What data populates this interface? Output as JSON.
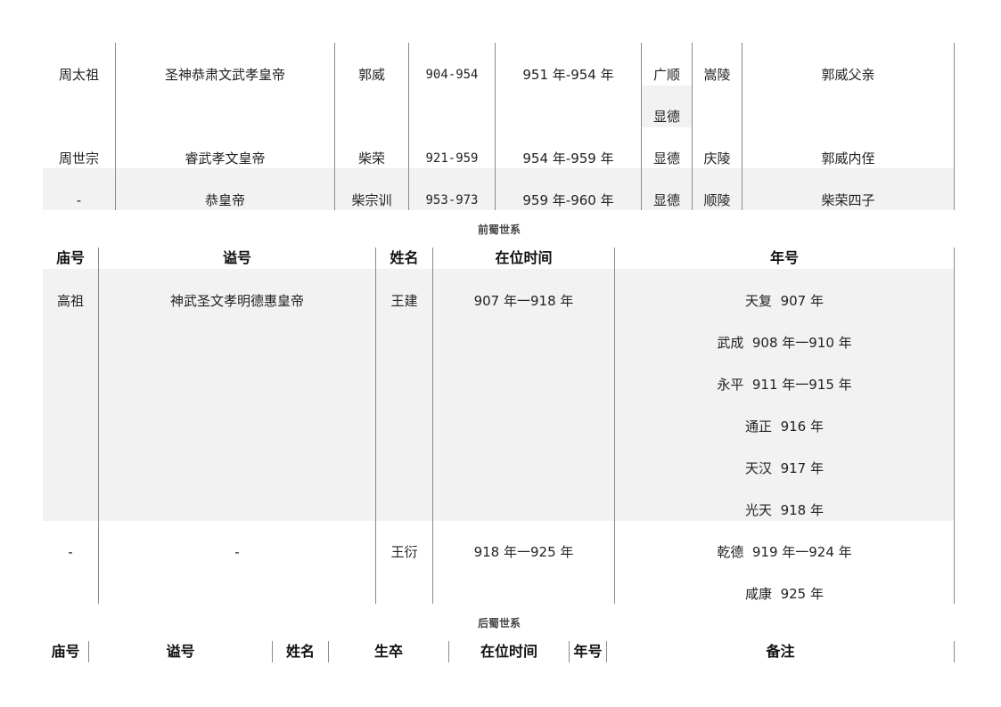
{
  "zhou_table": {
    "rows": [
      {
        "temple": "周太祖",
        "posthumous": "圣神恭肃文武孝皇帝",
        "name": "郭威",
        "life": "904-954",
        "reign": "951 年-954 年",
        "era": [
          "广顺",
          "显德"
        ],
        "tomb": "嵩陵",
        "note": "郭威父亲"
      },
      {
        "temple": "周世宗",
        "posthumous": "睿武孝文皇帝",
        "name": "柴荣",
        "life": "921-959",
        "reign": "954 年-959 年",
        "era": [
          "显德"
        ],
        "tomb": "庆陵",
        "note": "郭威内侄"
      },
      {
        "temple": "-",
        "posthumous": "恭皇帝",
        "name": "柴宗训",
        "life": "953-973",
        "reign": "959 年-960 年",
        "era": [
          "显德"
        ],
        "tomb": "顺陵",
        "note": "柴荣四子"
      }
    ]
  },
  "qianshu": {
    "caption": "前蜀世系",
    "headers": [
      "庙号",
      "谥号",
      "姓名",
      "在位时间",
      "年号"
    ],
    "rows": [
      {
        "temple": "高祖",
        "posthumous": "神武圣文孝明德惠皇帝",
        "name": "王建",
        "reign": "907 年一918 年",
        "eras": [
          "天复  907 年",
          "武成  908 年一910 年",
          "永平  911 年一915 年",
          "通正  916 年",
          "天汉  917 年",
          "光天  918 年"
        ]
      },
      {
        "temple": "-",
        "posthumous": "-",
        "name": "王衍",
        "reign": "918 年一925 年",
        "eras": [
          "乾德  919 年一924 年",
          "咸康  925 年"
        ]
      }
    ]
  },
  "houshu": {
    "caption": "后蜀世系",
    "headers": [
      "庙号",
      "谥号",
      "姓名",
      "生卒",
      "在位时间",
      "年号",
      "备注"
    ]
  }
}
